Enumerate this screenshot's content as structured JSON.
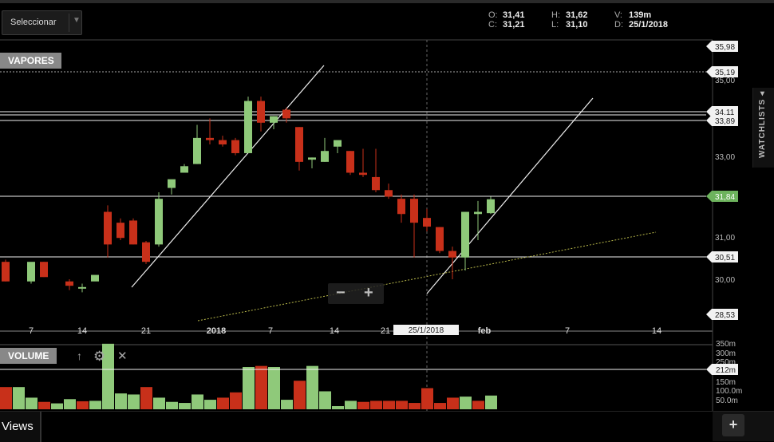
{
  "toolbar": {
    "select_label": "Seleccionar"
  },
  "ohlc": {
    "o_label": "O:",
    "o_value": "31,41",
    "h_label": "H:",
    "h_value": "31,62",
    "v_label": "V:",
    "v_value": "139m",
    "c_label": "C:",
    "c_value": "31,21",
    "l_label": "L:",
    "l_value": "31,10",
    "d_label": "D:",
    "d_value": "25/1/2018"
  },
  "watchlists_label": "WATCHLISTS ◂",
  "views_label": "Views",
  "add_label": "+",
  "zoom": {
    "minus": "−",
    "plus": "+"
  },
  "colors": {
    "up": "#8fc97a",
    "down": "#c8301a",
    "price_badge": "#6db35d"
  },
  "chart_data": [
    {
      "type": "candlestick",
      "title": "VAPORES",
      "x_tick_labels": [
        "7",
        "14",
        "21",
        "2018",
        "7",
        "14",
        "21",
        "25/1/2018",
        "feb",
        "7",
        "14"
      ],
      "crosshair_date": "25/1/2018",
      "y_ticks": [
        "35,00",
        "33,00",
        "31,00",
        "30,00"
      ],
      "price_lines": [
        "35,98",
        "35,19",
        "34,11",
        "33,89",
        "31,84",
        "30,51",
        "28,53"
      ],
      "current_price": "31,84",
      "candles": [
        {
          "o": 30.4,
          "h": 30.45,
          "c": 29.95,
          "l": 29.95
        },
        {
          "o": 29.95,
          "h": 30.0,
          "c": 30.4,
          "l": 29.9
        },
        {
          "o": 30.4,
          "h": 30.4,
          "c": 30.05,
          "l": 30.05
        },
        {
          "o": 29.95,
          "h": 30.0,
          "c": 29.85,
          "l": 29.75
        },
        {
          "o": 29.8,
          "h": 29.9,
          "c": 29.82,
          "l": 29.7
        },
        {
          "o": 29.95,
          "h": 29.9,
          "c": 30.1,
          "l": 29.9
        },
        {
          "o": 31.55,
          "h": 31.7,
          "c": 30.8,
          "l": 30.5
        },
        {
          "o": 31.3,
          "h": 31.4,
          "c": 30.95,
          "l": 30.9
        },
        {
          "o": 31.35,
          "h": 31.4,
          "c": 30.8,
          "l": 30.8
        },
        {
          "o": 30.85,
          "h": 30.88,
          "c": 30.4,
          "l": 30.35
        },
        {
          "o": 30.8,
          "h": 32.0,
          "c": 31.85,
          "l": 30.75
        },
        {
          "o": 32.1,
          "h": 32.2,
          "c": 32.3,
          "l": 31.95
        },
        {
          "o": 32.45,
          "h": 32.65,
          "c": 32.6,
          "l": 32.5
        },
        {
          "o": 32.65,
          "h": 33.55,
          "c": 33.25,
          "l": 32.65
        },
        {
          "o": 33.25,
          "h": 33.7,
          "c": 33.2,
          "l": 33.1
        },
        {
          "o": 33.2,
          "h": 33.3,
          "c": 33.1,
          "l": 33.05
        },
        {
          "o": 33.2,
          "h": 33.25,
          "c": 32.9,
          "l": 32.85
        },
        {
          "o": 32.9,
          "h": 34.2,
          "c": 34.1,
          "l": 32.9
        },
        {
          "o": 34.1,
          "h": 34.2,
          "c": 33.6,
          "l": 33.4
        },
        {
          "o": 33.6,
          "h": 33.75,
          "c": 33.75,
          "l": 33.45
        },
        {
          "o": 33.9,
          "h": 33.95,
          "c": 33.7,
          "l": 33.6
        },
        {
          "o": 33.5,
          "h": 33.5,
          "c": 32.7,
          "l": 32.5
        },
        {
          "o": 32.75,
          "h": 32.8,
          "c": 32.8,
          "l": 32.55
        },
        {
          "o": 32.7,
          "h": 33.25,
          "c": 32.95,
          "l": 32.7
        },
        {
          "o": 33.05,
          "h": 33.15,
          "c": 33.2,
          "l": 32.9
        },
        {
          "o": 32.95,
          "h": 32.95,
          "c": 32.45,
          "l": 32.4
        },
        {
          "o": 32.45,
          "h": 33.0,
          "c": 32.4,
          "l": 32.35
        },
        {
          "o": 32.35,
          "h": 33.0,
          "c": 32.05,
          "l": 32.0
        },
        {
          "o": 32.05,
          "h": 32.2,
          "c": 31.9,
          "l": 31.85
        },
        {
          "o": 31.85,
          "h": 31.95,
          "c": 31.5,
          "l": 31.3
        },
        {
          "o": 31.85,
          "h": 31.95,
          "c": 31.3,
          "l": 30.5
        },
        {
          "o": 31.41,
          "h": 31.62,
          "c": 31.21,
          "l": 31.1
        },
        {
          "o": 31.2,
          "h": 31.2,
          "c": 30.65,
          "l": 30.6
        },
        {
          "o": 30.65,
          "h": 30.75,
          "c": 30.5,
          "l": 30.0
        },
        {
          "o": 30.5,
          "h": 31.55,
          "c": 31.55,
          "l": 30.2
        },
        {
          "o": 31.5,
          "h": 31.8,
          "c": 31.55,
          "l": 30.9
        },
        {
          "o": 31.52,
          "h": 31.9,
          "c": 31.84,
          "l": 31.5
        }
      ]
    },
    {
      "type": "bar",
      "title": "VOLUME",
      "y_ticks": [
        "350m",
        "300m",
        "250m",
        "150m",
        "100.0m",
        "50.0m"
      ],
      "current_value": "212m",
      "values": [
        105,
        105,
        55,
        35,
        28,
        48,
        38,
        40,
        310,
        75,
        70,
        105,
        55,
        35,
        30,
        70,
        45,
        55,
        80,
        200,
        205,
        200,
        45,
        135,
        205,
        85,
        15,
        40,
        35,
        40,
        40,
        40,
        30,
        100,
        30,
        55,
        60,
        40,
        65
      ]
    }
  ]
}
